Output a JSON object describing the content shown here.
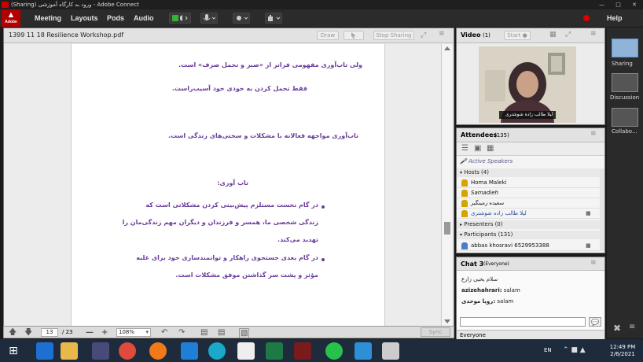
{
  "window": {
    "title": "(Sharing) ورود به کارگاه آموزشی - Adobe Connect"
  },
  "app_logo": {
    "text": "Adobe"
  },
  "menu": {
    "items": [
      "Meeting",
      "Layouts",
      "Pods",
      "Audio"
    ],
    "help": "Help"
  },
  "share_pod": {
    "title": "1399 11 18 Resilience Workshop.pdf",
    "buttons": [
      "Draw",
      "Stop Sharing"
    ]
  },
  "document": {
    "lines": [
      "ولی تاب‌آوری مفهومی فراتر از «صبر و تحمل صرف» است.",
      "فقط تحمل کردن به خودی خود آسیب‌زاست.",
      "تاب‌آوری مواجهه فعالانه با مشکلات و سختی‌های زندگی است.",
      "تاب آوری:",
      "در گام نخست مستلزم پیش‌بینی کردن مشکلاتی است که",
      "زندگی شخصی ما، همسر و فرزندان و دیگران مهم زندگی‌مان را",
      "تهدید می‌کند.",
      "در گام بعدی جستجوی راهکار و توانمندسازی خود برای غلبه",
      "مؤثر و پشت سر گذاشتن موفق مشکلات است."
    ]
  },
  "share_toolbar": {
    "page_current": "13",
    "page_total": "/ 23",
    "zoom": "108%",
    "sync": "Sync"
  },
  "video_pod": {
    "title": "Video",
    "count": "(1)",
    "start_label": "Start",
    "caption": "لیلا طالب زاده شوشتری"
  },
  "attendees_pod": {
    "title": "Attendees",
    "count": "(135)",
    "active_speakers": "Active Speakers",
    "hosts_label": "Hosts (4)",
    "hosts": [
      "Homa Maleki",
      "Samadieh",
      "سعیده زمینگیر",
      "لیلا طالب زاده شوشتری"
    ],
    "presenters_label": "Presenters (0)",
    "participants_label": "Participants (131)",
    "participants": [
      "abbas khosravi 6529953388"
    ]
  },
  "chat_pod": {
    "title": "Chat 3",
    "audience": "(Everyone)",
    "messages": [
      {
        "text": "سلام یحیی زارع"
      },
      {
        "sender": "azizehahrari:",
        "text": "salam"
      },
      {
        "sender": "رویا موحدی:",
        "text": "salam"
      }
    ],
    "tab": "Everyone"
  },
  "layouts_rail": {
    "items": [
      "Sharing",
      "Discussion",
      "Collabo..."
    ]
  },
  "taskbar": {
    "lang": "EN",
    "time": "12:49 PM",
    "date": "2/6/2021"
  },
  "colors": {
    "accent_purple": "#6a3d9a",
    "adobe_red": "#b40000",
    "rec_red": "#dd0000"
  }
}
